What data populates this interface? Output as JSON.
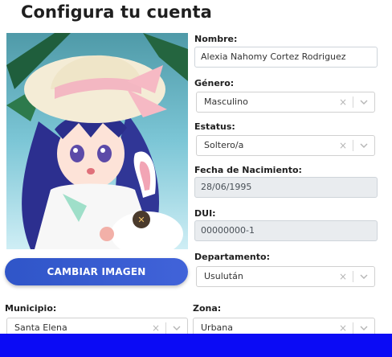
{
  "page": {
    "title": "Configura tu cuenta"
  },
  "profile": {
    "change_image_label": "CAMBIAR IMAGEN"
  },
  "form": {
    "nombre": {
      "label": "Nombre:",
      "value": "Alexia Nahomy Cortez Rodriguez"
    },
    "genero": {
      "label": "Género:",
      "value": "Masculino"
    },
    "estatus": {
      "label": "Estatus:",
      "value": "Soltero/a"
    },
    "fecha": {
      "label": "Fecha de Nacimiento:",
      "value": "28/06/1995"
    },
    "dui": {
      "label": "DUI:",
      "value": "00000000-1"
    },
    "departamento": {
      "label": "Departamento:",
      "value": "Usulután"
    },
    "municipio": {
      "label": "Municipio:",
      "value": "Santa Elena"
    },
    "zona": {
      "label": "Zona:",
      "value": "Urbana"
    }
  },
  "icons": {
    "clear": "×",
    "chevron": "chevron-down-icon"
  },
  "colors": {
    "button": "#3558cc",
    "bottom_bar": "#0b0bf5",
    "readonly_bg": "#e9ecef"
  }
}
